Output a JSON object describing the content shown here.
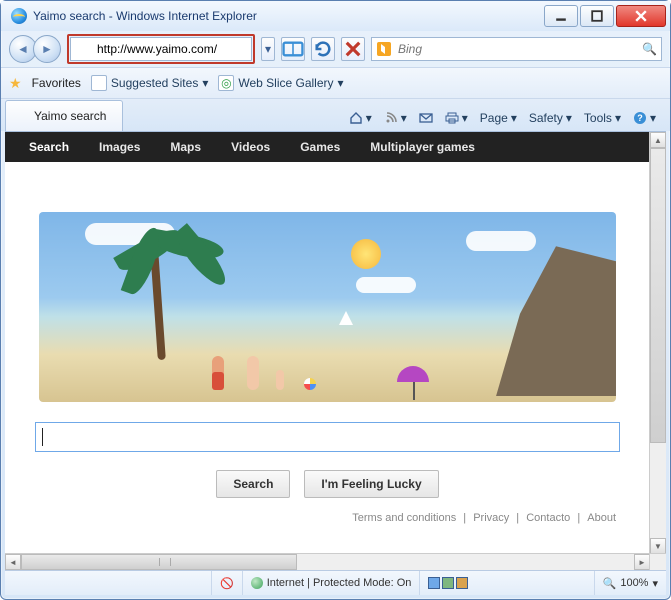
{
  "titlebar": {
    "title": "Yaimo search - Windows Internet Explorer"
  },
  "address": {
    "url": "http://www.yaimo.com/"
  },
  "search_provider": {
    "placeholder": "Bing"
  },
  "favbar": {
    "favorites": "Favorites",
    "suggested": "Suggested Sites",
    "webslice": "Web Slice Gallery"
  },
  "tab": {
    "title": "Yaimo search"
  },
  "commandbar": {
    "page": "Page",
    "safety": "Safety",
    "tools": "Tools"
  },
  "site_nav": {
    "search": "Search",
    "images": "Images",
    "maps": "Maps",
    "videos": "Videos",
    "games": "Games",
    "multiplayer": "Multiplayer games"
  },
  "buttons": {
    "search": "Search",
    "lucky": "I'm Feeling Lucky"
  },
  "footer": {
    "terms": "Terms and conditions",
    "privacy": "Privacy",
    "contacto": "Contacto",
    "about": "About"
  },
  "status": {
    "zone": "Internet | Protected Mode: On",
    "zoom": "100%"
  }
}
